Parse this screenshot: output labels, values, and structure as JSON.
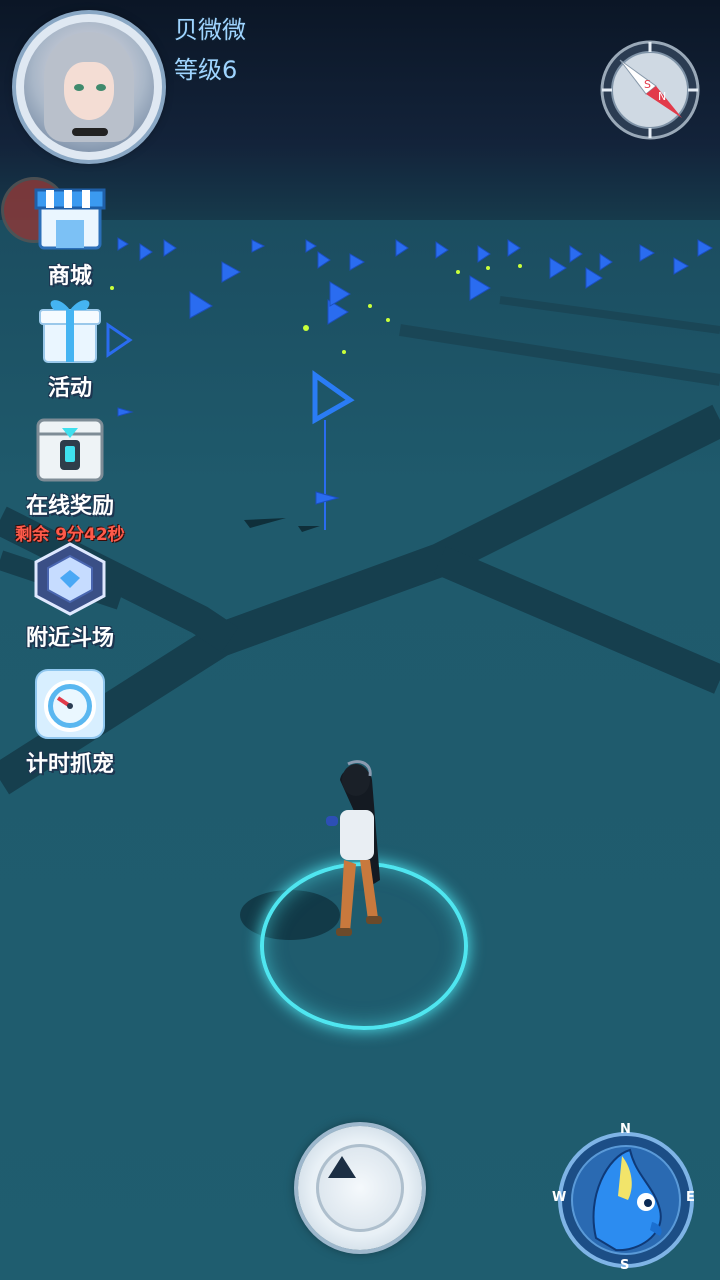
{
  "player": {
    "name": "贝微微",
    "level": "等级6"
  },
  "compass": {
    "north_letter": "N",
    "south_letter": "S"
  },
  "side_menu": {
    "shop": {
      "label": "商城",
      "icon": "shop-icon"
    },
    "events": {
      "label": "活动",
      "icon": "gift-icon"
    },
    "online_reward": {
      "label": "在线奖励",
      "icon": "chest-icon",
      "timer": "剩余 9分42秒"
    },
    "nearby_arena": {
      "label": "附近斗场",
      "icon": "arena-icon"
    },
    "timed_catch": {
      "label": "计时抓宠",
      "icon": "stopwatch-icon"
    }
  },
  "radar": {
    "n": "N",
    "s": "S",
    "w": "W",
    "e": "E",
    "icon": "blue-pet-icon"
  },
  "center_button": {
    "icon": "up-arrow-icon"
  },
  "colors": {
    "ring": "#4fe6f0",
    "name_text": "#9fd4ff",
    "timer_text": "#ff5a4a",
    "ground": "#1f5a6c"
  }
}
